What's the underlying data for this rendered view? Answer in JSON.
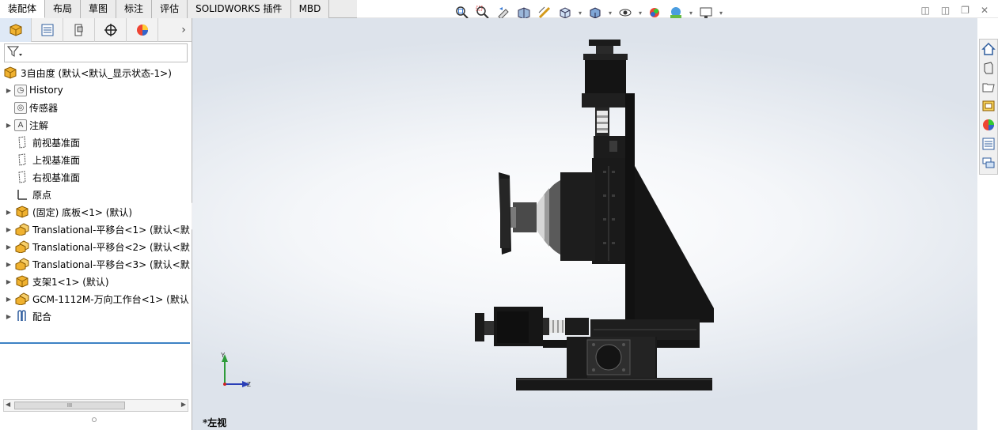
{
  "tabs": [
    "装配体",
    "布局",
    "草图",
    "标注",
    "评估",
    "SOLIDWORKS 插件",
    "MBD"
  ],
  "active_tab": 0,
  "view_toolbar": [
    "zoom-to-fit-icon",
    "zoom-to-area-icon",
    "previous-view-icon",
    "section-view-icon",
    "dynamic-annotation-icon",
    "view-orientation-icon",
    "display-style-icon",
    "hide-show-icon",
    "edit-appearance-icon",
    "apply-scene-icon",
    "view-settings-icon"
  ],
  "panel_tabs": [
    "feature-manager-icon",
    "property-manager-icon",
    "configuration-manager-icon",
    "dimxpert-icon",
    "display-manager-icon"
  ],
  "tree": {
    "root": "3自由度  (默认<默认_显示状态-1>)",
    "items": [
      {
        "label": "History",
        "icon": "history-icon",
        "expand": true
      },
      {
        "label": "传感器",
        "icon": "sensor-icon",
        "expand": false
      },
      {
        "label": "注解",
        "icon": "annotation-icon",
        "expand": true
      },
      {
        "label": "前视基准面",
        "icon": "plane-icon",
        "expand": false
      },
      {
        "label": "上视基准面",
        "icon": "plane-icon",
        "expand": false
      },
      {
        "label": "右视基准面",
        "icon": "plane-icon",
        "expand": false
      },
      {
        "label": "原点",
        "icon": "origin-icon",
        "expand": false
      },
      {
        "label": "(固定) 底板<1> (默认)",
        "icon": "part-icon",
        "expand": true
      },
      {
        "label": "Translational-平移台<1> (默认<默",
        "icon": "subassembly-icon",
        "expand": true
      },
      {
        "label": "Translational-平移台<2> (默认<默",
        "icon": "subassembly-icon",
        "expand": true
      },
      {
        "label": "Translational-平移台<3> (默认<默",
        "icon": "subassembly-icon",
        "expand": true
      },
      {
        "label": "支架1<1> (默认)",
        "icon": "part-icon",
        "expand": true
      },
      {
        "label": "GCM-1112M-万向工作台<1> (默认",
        "icon": "subassembly-icon",
        "expand": true
      },
      {
        "label": "配合",
        "icon": "mates-icon",
        "expand": true
      }
    ]
  },
  "scroll_thumb": "III",
  "view_label": "*左视",
  "triad": {
    "y": "Y",
    "z": "Z"
  },
  "right_toolbar": [
    "home-icon",
    "design-library-icon",
    "file-explorer-icon",
    "view-palette-icon",
    "appearances-icon",
    "custom-properties-icon",
    "forum-icon"
  ],
  "colors": {
    "accent": "#3d82c4",
    "model": "#1a1a1a",
    "triad_y": "#2e9b3a",
    "triad_z": "#2a3fb7"
  }
}
